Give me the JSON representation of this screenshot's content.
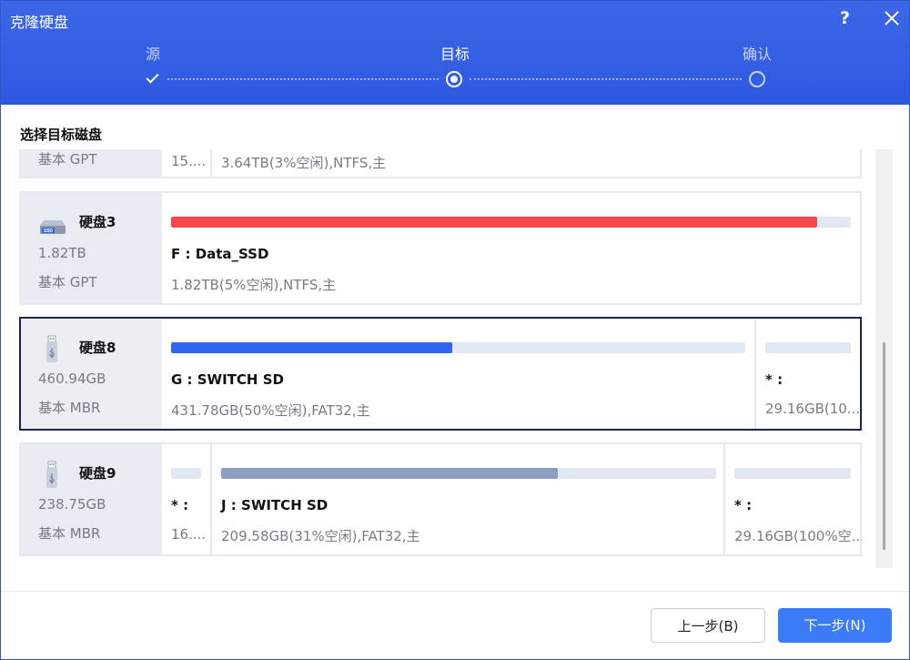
{
  "window": {
    "title": "克隆硬盘",
    "help_label": "?",
    "close_label": "×"
  },
  "steps": [
    {
      "label": "源",
      "state": "done"
    },
    {
      "label": "目标",
      "state": "active"
    },
    {
      "label": "确认",
      "state": "pending"
    }
  ],
  "section_title": "选择目标磁盘",
  "colors": {
    "header": "#3061e3",
    "selected_border": "#1c2451",
    "next_button": "#3c7bf6",
    "bar_red": "#f5464e",
    "bar_blue": "#3066f2",
    "bar_gray": "#8c9ec4",
    "bar_track": "#e1e8f2"
  },
  "disks": [
    {
      "name": "",
      "size": "",
      "type": "基本 GPT",
      "partitions": [
        {
          "label": "",
          "detail": "15....",
          "used_fraction": null
        },
        {
          "label": "",
          "detail": "3.64TB(3%空闲),NTFS,主",
          "used_fraction": null
        }
      ]
    },
    {
      "name": "硬盘3",
      "icon": "ssd-icon",
      "size": "1.82TB",
      "type": "基本 GPT",
      "partitions": [
        {
          "label": "F : Data_SSD",
          "detail": "1.82TB(5%空闲),NTFS,主",
          "used_fraction": 0.95,
          "bar_color": "#f5464e"
        }
      ]
    },
    {
      "name": "硬盘8",
      "icon": "usb-drive-icon",
      "size": "460.94GB",
      "type": "基本 MBR",
      "selected": true,
      "partitions": [
        {
          "label": "G : SWITCH SD",
          "detail": "431.78GB(50%空闲),FAT32,主",
          "used_fraction": 0.5,
          "bar_color": "#3066f2"
        },
        {
          "label": "* :",
          "detail": "29.16GB(10...",
          "used_fraction": 0.0,
          "bar_color": "#8c9ec4"
        }
      ]
    },
    {
      "name": "硬盘9",
      "icon": "usb-drive-icon",
      "size": "238.75GB",
      "type": "基本 MBR",
      "partitions": [
        {
          "label": "* :",
          "detail": "16....",
          "used_fraction": 0.0,
          "bar_color": "#8c9ec4"
        },
        {
          "label": "J : SWITCH SD",
          "detail": "209.58GB(31%空闲),FAT32,主",
          "used_fraction": 0.69,
          "bar_color": "#8c9ec4"
        },
        {
          "label": "* :",
          "detail": "29.16GB(100%空...",
          "used_fraction": 0.0,
          "bar_color": "#8c9ec4"
        }
      ]
    }
  ],
  "buttons": {
    "prev": "上一步(B)",
    "next": "下一步(N)"
  }
}
